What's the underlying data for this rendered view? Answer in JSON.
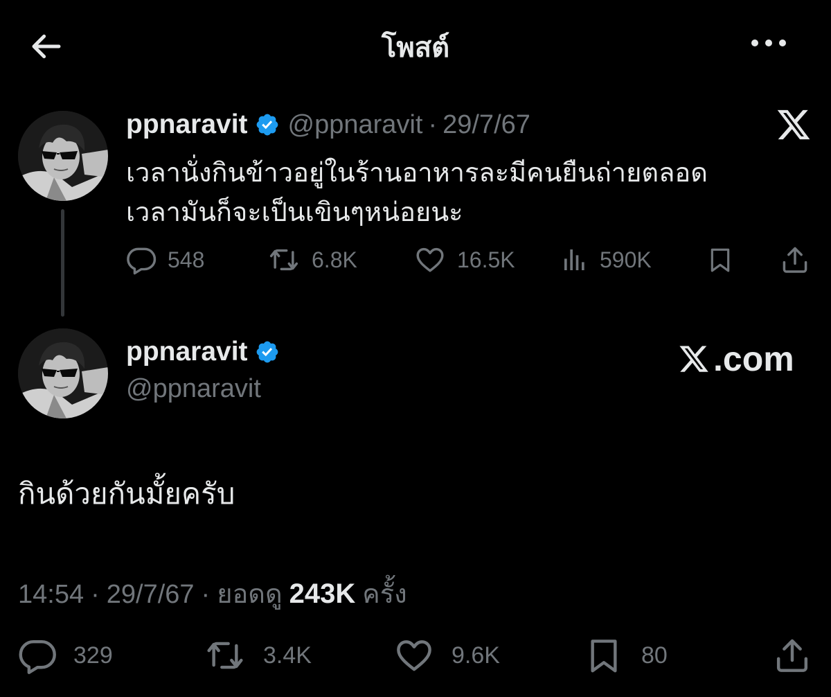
{
  "header": {
    "title": "โพสต์",
    "back_icon": "arrow-left-icon",
    "more_icon": "more-horizontal-icon"
  },
  "parent_post": {
    "display_name": "ppnaravit",
    "handle": "@ppnaravit",
    "separator": "·",
    "date": "29/7/67",
    "text": "เวลานั่งกินข้าวอยู่ในร้านอาหารละมีคนยืนถ่ายตลอด เวลามันก็จะเป็นเขินๆหน่อยนะ",
    "text_line1": "เวลานั่งกินข้าวอยู่ในร้านอาหารละมีคนยืนถ่ายตลอด",
    "text_line2": "เวลามันก็จะเป็นเขินๆหน่อยนะ",
    "replies": "548",
    "reposts": "6.8K",
    "likes": "16.5K",
    "views": "590K"
  },
  "main_post": {
    "display_name": "ppnaravit",
    "handle": "@ppnaravit",
    "text": "กินด้วยกันมั้ยครับ",
    "time": "14:54",
    "separator": "·",
    "date": "29/7/67",
    "views_label": "ยอดดู",
    "views": "243K",
    "views_suffix": "ครั้ง",
    "replies": "329",
    "reposts": "3.4K",
    "likes": "9.6K",
    "bookmarks": "80"
  },
  "watermark": {
    "domain_text": ".com"
  },
  "colors": {
    "background": "#000000",
    "text_primary": "#e7e9ea",
    "text_secondary": "#71767b",
    "verified_badge": "#1d9bf0",
    "thread_line": "#333639"
  }
}
